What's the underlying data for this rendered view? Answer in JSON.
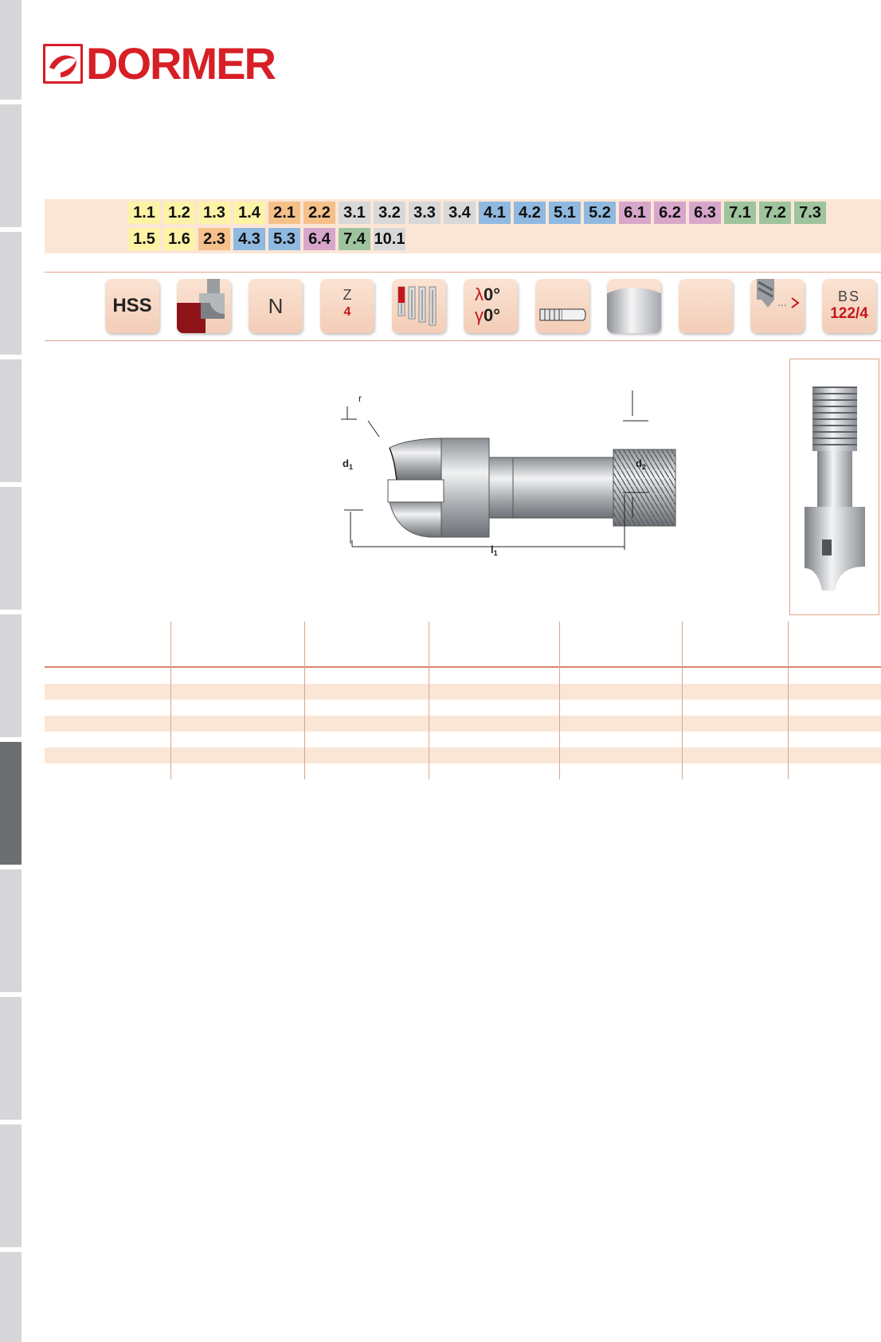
{
  "brand": {
    "name": "DORMER",
    "color": "#d71f26"
  },
  "side_tabs": {
    "active_index": 5,
    "inactive_color": "#d6d6d8",
    "active_color": "#6d6e72"
  },
  "material_groups": {
    "row1": [
      {
        "label": "1.1",
        "color": "yellow"
      },
      {
        "label": "1.2",
        "color": "yellow"
      },
      {
        "label": "1.3",
        "color": "yellow"
      },
      {
        "label": "1.4",
        "color": "yellow"
      },
      {
        "label": "2.1",
        "color": "orange"
      },
      {
        "label": "2.2",
        "color": "orange"
      },
      {
        "label": "3.1",
        "color": "grey"
      },
      {
        "label": "3.2",
        "color": "grey"
      },
      {
        "label": "3.3",
        "color": "grey"
      },
      {
        "label": "3.4",
        "color": "grey"
      },
      {
        "label": "4.1",
        "color": "blue"
      },
      {
        "label": "4.2",
        "color": "blue"
      },
      {
        "label": "5.1",
        "color": "blue"
      },
      {
        "label": "5.2",
        "color": "blue"
      },
      {
        "label": "6.1",
        "color": "purple"
      },
      {
        "label": "6.2",
        "color": "purple"
      },
      {
        "label": "6.3",
        "color": "purple"
      },
      {
        "label": "7.1",
        "color": "green"
      },
      {
        "label": "7.2",
        "color": "green"
      },
      {
        "label": "7.3",
        "color": "green"
      }
    ],
    "row2": [
      {
        "label": "1.5",
        "color": "yellow"
      },
      {
        "label": "1.6",
        "color": "yellow"
      },
      {
        "label": "2.3",
        "color": "orange"
      },
      {
        "label": "4.3",
        "color": "blue"
      },
      {
        "label": "5.3",
        "color": "blue"
      },
      {
        "label": "6.4",
        "color": "purple"
      },
      {
        "label": "7.4",
        "color": "green"
      },
      {
        "label": "10.1",
        "color": "grey"
      }
    ]
  },
  "icons": {
    "material": "HSS",
    "cutter_type_icon": "corner-rounding-cutter-icon",
    "type_letter": "N",
    "z_label": "Z",
    "z_value": "4",
    "tolerance_icon": "tool-series-icon",
    "lambda_symbol": "λ",
    "lambda_value": "0°",
    "gamma_symbol": "γ",
    "gamma_value": "0°",
    "shank_icon": "threaded-shank-icon",
    "finish_icon": "bright-finish-icon",
    "coating_icon": "uncoated-icon",
    "direction_icon": "feed-direction-icon",
    "standard_top": "BS",
    "standard_bottom": "122/4"
  },
  "drawing": {
    "label_r": "r",
    "label_d1": "d",
    "label_d1_sub": "1",
    "label_d2": "d",
    "label_d2_sub": "2",
    "label_l1": "l",
    "label_l1_sub": "1"
  },
  "table": {
    "header_columns": 7,
    "rows": 7
  }
}
